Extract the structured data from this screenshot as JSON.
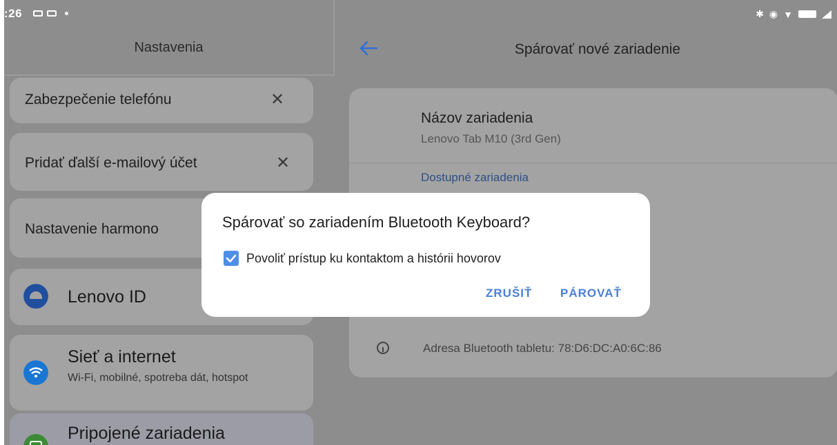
{
  "status_bar": {
    "time": ":26"
  },
  "left_pane": {
    "title": "Nastavenia",
    "suggestions": [
      {
        "label": "Zabezpečenie telefónu",
        "dismiss": "✕"
      },
      {
        "label": "Pridať ďalší e-mailový účet",
        "dismiss": "✕"
      },
      {
        "label": "Nastavenie harmono"
      }
    ],
    "items": [
      {
        "title": "Lenovo ID",
        "icon": "user-icon",
        "color": "#1f4f9e"
      },
      {
        "title": "Sieť a internet",
        "subtitle": "Wi-Fi, mobilné, spotreba dát, hotspot",
        "icon": "wifi-icon",
        "color": "#1976d2"
      },
      {
        "title": "Pripojené zariadenia",
        "icon": "devices-icon",
        "color": "#3d8b37"
      }
    ]
  },
  "right_pane": {
    "title": "Spárovať nové zariadenie",
    "device_name_label": "Názov zariadenia",
    "device_name_value": "Lenovo Tab M10 (3rd Gen)",
    "available_label": "Dostupné zariadenia",
    "bt_address": "Adresa Bluetooth tabletu: 78:D6:DC:A0:6C:86"
  },
  "dialog": {
    "title": "Spárovať so zariadením Bluetooth Keyboard?",
    "checkbox_label": "Povoliť prístup ku kontaktom a histórii hovorov",
    "checkbox_checked": true,
    "cancel_label": "ZRUŠIŤ",
    "confirm_label": "PÁROVAŤ"
  },
  "colors": {
    "accent": "#4a7fd6",
    "checkbox": "#4d8ee8",
    "available_heading": "#2d4f86"
  }
}
